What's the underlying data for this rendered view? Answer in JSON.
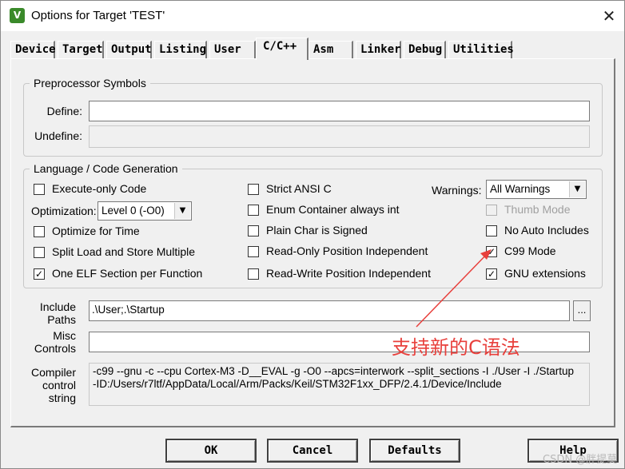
{
  "window": {
    "title": "Options for Target 'TEST'",
    "app_icon": "keil-uvision-icon",
    "close_glyph": "✕"
  },
  "tabs": [
    {
      "label": "Device",
      "active": false
    },
    {
      "label": "Target",
      "active": false
    },
    {
      "label": "Output",
      "active": false
    },
    {
      "label": "Listing",
      "active": false
    },
    {
      "label": "User",
      "active": false
    },
    {
      "label": "C/C++",
      "active": true
    },
    {
      "label": "Asm",
      "active": false
    },
    {
      "label": "Linker",
      "active": false
    },
    {
      "label": "Debug",
      "active": false
    },
    {
      "label": "Utilities",
      "active": false
    }
  ],
  "preprocessor": {
    "title": "Preprocessor Symbols",
    "define_label": "Define:",
    "define_value": "",
    "undefine_label": "Undefine:",
    "undefine_value": ""
  },
  "language": {
    "title": "Language / Code Generation",
    "checkboxes": [
      {
        "label": "Execute-only Code",
        "checked": false,
        "enabled": true
      },
      {
        "label": "Optimize for Time",
        "checked": false,
        "enabled": true
      },
      {
        "label": "Split Load and Store Multiple",
        "checked": false,
        "enabled": true
      },
      {
        "label": "One ELF Section per Function",
        "checked": true,
        "enabled": true
      },
      {
        "label": "Strict ANSI C",
        "checked": false,
        "enabled": true
      },
      {
        "label": "Enum Container always int",
        "checked": false,
        "enabled": true
      },
      {
        "label": "Plain Char is Signed",
        "checked": false,
        "enabled": true
      },
      {
        "label": "Read-Only Position Independent",
        "checked": false,
        "enabled": true
      },
      {
        "label": "Read-Write Position Independent",
        "checked": false,
        "enabled": true
      },
      {
        "label": "Thumb Mode",
        "checked": false,
        "enabled": false
      },
      {
        "label": "No Auto Includes",
        "checked": false,
        "enabled": true
      },
      {
        "label": "C99 Mode",
        "checked": true,
        "enabled": true
      },
      {
        "label": "GNU extensions",
        "checked": true,
        "enabled": true
      }
    ],
    "optimization_label": "Optimization:",
    "optimization_value": "Level 0 (-O0)",
    "warnings_label": "Warnings:",
    "warnings_value": "All Warnings"
  },
  "include_paths": {
    "label": "Include\nPaths",
    "value": ".\\User;.\\Startup",
    "browse_label": "..."
  },
  "misc_controls": {
    "label": "Misc\nControls",
    "value": ""
  },
  "compiler_control": {
    "label": "Compiler\ncontrol\nstring",
    "value": "-c99 --gnu -c --cpu Cortex-M3 -D__EVAL -g -O0 --apcs=interwork --split_sections -I ./User -I ./Startup\n-ID:/Users/r7ltf/AppData/Local/Arm/Packs/Keil/STM32F1xx_DFP/2.4.1/Device/Include"
  },
  "annotation": {
    "text": "支持新的C语法",
    "color": "#e8403c"
  },
  "buttons": {
    "ok": "OK",
    "cancel": "Cancel",
    "defaults": "Defaults",
    "help": "Help"
  },
  "watermark": "CSDN @胖提莫"
}
